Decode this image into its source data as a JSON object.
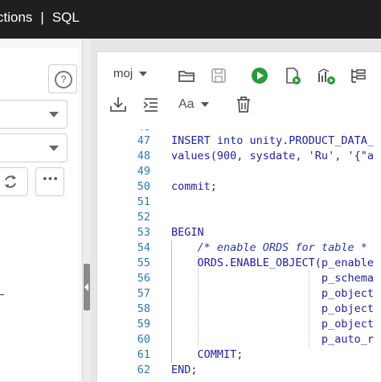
{
  "topbar": {
    "section": "ctions",
    "page": "SQL"
  },
  "left": {
    "help_glyph": "?",
    "more_glyph": "•••"
  },
  "toolbar": {
    "schema": "moj",
    "font_label": "Aa"
  },
  "editor": {
    "line_numbers": [
      "48",
      "47",
      "48",
      "49",
      "50",
      "51",
      "52",
      "53",
      "54",
      "55",
      "56",
      "57",
      "58",
      "59",
      "60",
      "61",
      "62"
    ],
    "lines": [
      "",
      "INSERT into unity.PRODUCT_DATA_",
      "values(900, sysdate, 'Ru', '{\"a",
      "",
      "commit;",
      "",
      "",
      "BEGIN",
      "    /* enable ORDS for table *",
      "    ORDS.ENABLE_OBJECT(p_enable",
      "                       p_schema",
      "                       p_object",
      "                       p_object",
      "                       p_object",
      "                       p_auto_r",
      "    COMMIT;",
      "END;"
    ]
  }
}
